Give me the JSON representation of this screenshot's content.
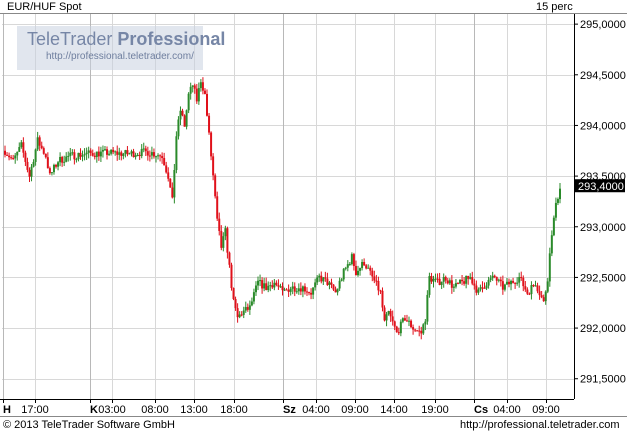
{
  "header": {
    "instrument": "EUR/HUF Spot",
    "interval": "15 perc"
  },
  "watermark": {
    "brand_part1": "TeleTrader",
    "brand_part2": "Professional",
    "url": "http://professional.teletrader.com/"
  },
  "footer": {
    "copyright": "© 2013 TeleTrader Software GmbH",
    "url": "http://professional.teletrader.com"
  },
  "colors": {
    "up": "#2a8a2a",
    "down": "#e0101a",
    "grid": "#d8d8d8",
    "highlight": "#000000"
  },
  "chart_data": {
    "type": "candlestick",
    "title": "EUR/HUF Spot",
    "interval": "15 perc",
    "last_price": "293,4000",
    "last_value": 293.4,
    "ylim": [
      291.3,
      295.1
    ],
    "y_ticks": [
      {
        "value": 295.0,
        "label": "295,0000"
      },
      {
        "value": 294.5,
        "label": "294,5000"
      },
      {
        "value": 294.0,
        "label": "294,0000"
      },
      {
        "value": 293.5,
        "label": "293,5000"
      },
      {
        "value": 293.0,
        "label": "293,0000"
      },
      {
        "value": 292.5,
        "label": "292,5000"
      },
      {
        "value": 292.0,
        "label": "292,0000"
      },
      {
        "value": 291.5,
        "label": "291,5000"
      }
    ],
    "x_ticks": [
      {
        "label": "H",
        "bold": true,
        "day": true
      },
      {
        "label": "17:00"
      },
      {
        "label": "K",
        "bold": true,
        "day": true
      },
      {
        "label": "03:00"
      },
      {
        "label": "08:00"
      },
      {
        "label": "13:00"
      },
      {
        "label": "18:00"
      },
      {
        "label": "Sz",
        "bold": true,
        "day": true
      },
      {
        "label": "04:00"
      },
      {
        "label": "09:00"
      },
      {
        "label": "14:00"
      },
      {
        "label": "19:00"
      },
      {
        "label": "Cs",
        "bold": true,
        "day": true
      },
      {
        "label": "04:00"
      },
      {
        "label": "09:00"
      }
    ],
    "grid": true,
    "price_path": [
      [
        0,
        293.75
      ],
      [
        4,
        293.65
      ],
      [
        8,
        293.8
      ],
      [
        12,
        293.5
      ],
      [
        16,
        293.85
      ],
      [
        20,
        293.7
      ],
      [
        22,
        293.5
      ],
      [
        26,
        293.65
      ],
      [
        32,
        293.7
      ],
      [
        40,
        293.72
      ],
      [
        50,
        293.73
      ],
      [
        60,
        293.72
      ],
      [
        70,
        293.74
      ],
      [
        77,
        293.7
      ],
      [
        80,
        293.5
      ],
      [
        82,
        293.25
      ],
      [
        84,
        293.9
      ],
      [
        86,
        294.15
      ],
      [
        88,
        294.0
      ],
      [
        90,
        294.3
      ],
      [
        92,
        294.4
      ],
      [
        94,
        294.25
      ],
      [
        96,
        294.45
      ],
      [
        98,
        294.3
      ],
      [
        100,
        293.9
      ],
      [
        102,
        293.5
      ],
      [
        104,
        293.05
      ],
      [
        106,
        292.8
      ],
      [
        108,
        292.95
      ],
      [
        110,
        292.6
      ],
      [
        112,
        292.25
      ],
      [
        114,
        292.1
      ],
      [
        116,
        292.15
      ],
      [
        120,
        292.2
      ],
      [
        124,
        292.45
      ],
      [
        128,
        292.4
      ],
      [
        132,
        292.45
      ],
      [
        136,
        292.35
      ],
      [
        140,
        292.4
      ],
      [
        146,
        292.4
      ],
      [
        150,
        292.35
      ],
      [
        154,
        292.5
      ],
      [
        158,
        292.45
      ],
      [
        162,
        292.35
      ],
      [
        166,
        292.55
      ],
      [
        170,
        292.7
      ],
      [
        172,
        292.55
      ],
      [
        176,
        292.65
      ],
      [
        180,
        292.5
      ],
      [
        184,
        292.35
      ],
      [
        186,
        292.05
      ],
      [
        188,
        292.15
      ],
      [
        192,
        291.95
      ],
      [
        196,
        292.1
      ],
      [
        200,
        292.0
      ],
      [
        204,
        291.95
      ],
      [
        206,
        292.1
      ],
      [
        208,
        292.5
      ],
      [
        212,
        292.45
      ],
      [
        216,
        292.5
      ],
      [
        220,
        292.4
      ],
      [
        224,
        292.45
      ],
      [
        228,
        292.5
      ],
      [
        232,
        292.35
      ],
      [
        236,
        292.45
      ],
      [
        240,
        292.5
      ],
      [
        244,
        292.4
      ],
      [
        248,
        292.45
      ],
      [
        252,
        292.5
      ],
      [
        256,
        292.35
      ],
      [
        260,
        292.45
      ],
      [
        264,
        292.25
      ],
      [
        266,
        292.5
      ],
      [
        268,
        292.95
      ],
      [
        270,
        293.2
      ],
      [
        272,
        293.4
      ]
    ]
  }
}
